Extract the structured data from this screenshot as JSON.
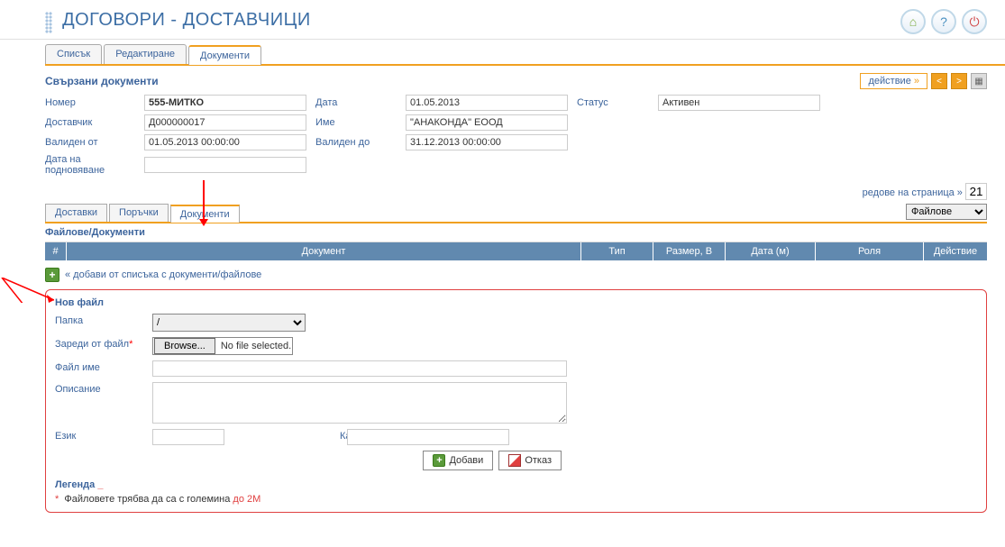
{
  "title": "ДОГОВОРИ - ДОСТАВЧИЦИ",
  "main_tabs": {
    "list": "Списък",
    "edit": "Редактиране",
    "docs": "Документи"
  },
  "section": {
    "title": "Свързани документи",
    "action": "действие"
  },
  "form": {
    "number_label": "Номер",
    "number": "555-МИТКО",
    "date_label": "Дата",
    "date": "01.05.2013",
    "status_label": "Статус",
    "status": "Активен",
    "supplier_label": "Доставчик",
    "supplier": "Д000000017",
    "name_label": "Име",
    "name": "\"АНАКОНДА\" ЕООД",
    "valid_from_label": "Валиден от",
    "valid_from": "01.05.2013 00:00:00",
    "valid_to_label": "Валиден до",
    "valid_to": "31.12.2013 00:00:00",
    "renewal_label": "Дата на подновяване",
    "renewal": ""
  },
  "rows_label": "редове на страница »",
  "rows_value": "21",
  "sub_tabs": {
    "deliveries": "Доставки",
    "orders": "Поръчки",
    "docs": "Документи"
  },
  "files_select": "Файлове",
  "files_title": "Файлове/Документи",
  "table": {
    "hash": "#",
    "doc": "Документ",
    "type": "Тип",
    "size": "Размер, B",
    "date": "Дата (м)",
    "role": "Роля",
    "action": "Действие"
  },
  "add_link": "« добави от списъка с документи/файлове",
  "new_file": {
    "title": "Нов файл",
    "folder_label": "Папка",
    "folder": "/",
    "load_label": "Зареди от файл",
    "browse": "Browse...",
    "no_file": "No file selected.",
    "filename_label": "Файл име",
    "desc_label": "Описание",
    "lang_label": "Език",
    "kato_label": "Като",
    "add_btn": "Добави",
    "cancel_btn": "Отказ"
  },
  "legend": {
    "title": "Легенда",
    "text": "Файловете трябва да са с големина ",
    "limit": "до 2M"
  }
}
